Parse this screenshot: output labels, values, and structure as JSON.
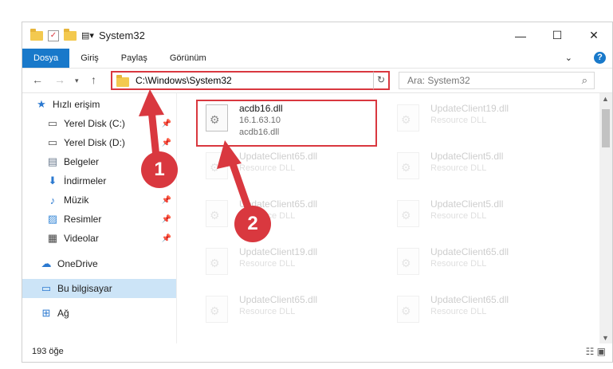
{
  "window": {
    "title": "System32",
    "minimize": "—",
    "maximize": "☐",
    "close": "✕"
  },
  "ribbon": {
    "tabs": [
      "Dosya",
      "Giriş",
      "Paylaş",
      "Görünüm"
    ],
    "help": "?"
  },
  "navbar": {
    "address": "C:\\Windows\\System32",
    "search_placeholder": "Ara: System32"
  },
  "sidebar": {
    "quick_access": "Hızlı erişim",
    "items": [
      "Yerel Disk (C:)",
      "Yerel Disk (D:)",
      "Belgeler",
      "İndirmeler",
      "Müzik",
      "Resimler",
      "Videolar"
    ],
    "onedrive": "OneDrive",
    "thispc": "Bu bilgisayar",
    "network": "Ağ"
  },
  "files": [
    {
      "name": "acdb16.dll",
      "line2": "16.1.63.10",
      "line3": "acdb16.dll"
    },
    {
      "name": "UpdateClient19.dll",
      "line2": "Resource DLL"
    },
    {
      "name": "UpdateClient65.dll",
      "line2": "Resource DLL"
    },
    {
      "name": "UpdateClient5.dll",
      "line2": "Resource DLL"
    },
    {
      "name": "UpdateClient65.dll",
      "line2": "Resource DLL"
    },
    {
      "name": "UpdateClient5.dll",
      "line2": "Resource DLL"
    },
    {
      "name": "UpdateClient19.dll",
      "line2": "Resource DLL"
    },
    {
      "name": "UpdateClient65.dll",
      "line2": "Resource DLL"
    },
    {
      "name": "UpdateClient65.dll",
      "line2": "Resource DLL"
    },
    {
      "name": "UpdateClient65.dll",
      "line2": "Resource DLL"
    }
  ],
  "status": {
    "count": "193 öğe"
  },
  "callouts": [
    "1",
    "2"
  ],
  "colors": {
    "accent": "#1979ca",
    "highlight": "#d9383f"
  }
}
